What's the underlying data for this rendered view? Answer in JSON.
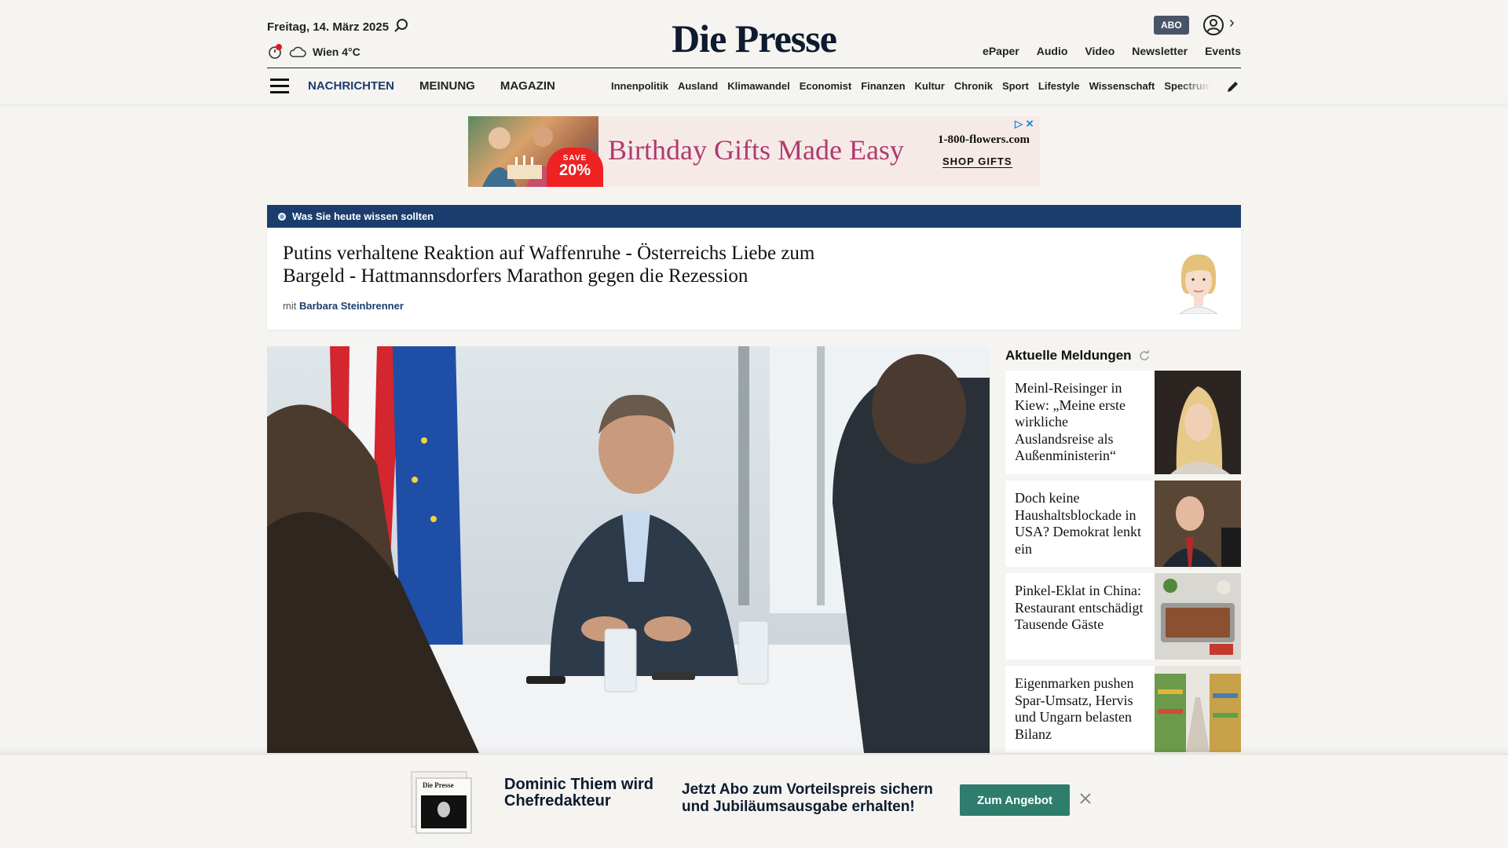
{
  "header": {
    "date": "Freitag, 14. März 2025",
    "weather": "Wien 4°C",
    "logo": "Die Presse",
    "abo_label": "ABO",
    "top_links": [
      "ePaper",
      "Audio",
      "Video",
      "Newsletter",
      "Events"
    ],
    "main_nav": [
      "NACHRICHTEN",
      "MEINUNG",
      "MAGAZIN"
    ],
    "sub_nav": [
      "Innenpolitik",
      "Ausland",
      "Klimawandel",
      "Economist",
      "Finanzen",
      "Kultur",
      "Chronik",
      "Sport",
      "Lifestyle",
      "Wissenschaft",
      "Spectrum"
    ]
  },
  "ad": {
    "headline": "Birthday Gifts Made Easy",
    "brand": "1-800-flowers.com",
    "cta": "SHOP GIFTS",
    "save_label": "SAVE",
    "save_value": "20%"
  },
  "briefing": {
    "label": "Was Sie heute wissen sollten",
    "title": "Putins verhaltene Reaktion auf Waffenruhe - Österreichs Liebe zum Bargeld - Hattmannsdorfers Marathon gegen die Rezession",
    "author_prefix": "mit",
    "author": "Barbara Steinbrenner"
  },
  "sidebar": {
    "title": "Aktuelle Meldungen",
    "items": [
      {
        "title": "Meinl-Reisinger in Kiew: „Meine erste wirkliche Auslandsreise als Außenministerin“"
      },
      {
        "title": "Doch keine Haushaltsblockade in USA? Demokrat lenkt ein"
      },
      {
        "title": "Pinkel-Eklat in China: Restaurant entschädigt Tausende Gäste"
      },
      {
        "title": "Eigenmarken pushen Spar-Umsatz, Hervis und Ungarn belasten Bilanz"
      }
    ]
  },
  "banner": {
    "headline": "Dominic Thiem wird Chefredakteur",
    "offer": "Jetzt Abo zum Vorteilspreis sichern und Jubiläumsausgabe erhalten!",
    "button": "Zum Angebot"
  }
}
